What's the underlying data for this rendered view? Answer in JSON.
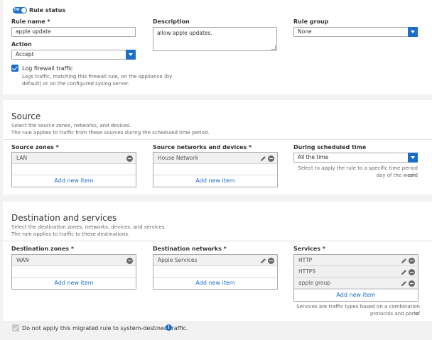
{
  "rule_status": {
    "toggle_label": "ON",
    "label": "Rule status"
  },
  "rule_name": {
    "label": "Rule name *",
    "value": "apple update"
  },
  "description": {
    "label": "Description",
    "value": "allow apple updates."
  },
  "rule_group": {
    "label": "Rule group",
    "value": "None"
  },
  "action": {
    "label": "Action",
    "value": "Accept"
  },
  "log": {
    "label": "Log firewall traffic",
    "hint_line1": "Logs traffic, matching this firewall rule, on the appliance (by",
    "hint_line2": "default) or on the configured syslog server.",
    "checked": true
  },
  "source": {
    "title": "Source",
    "desc_line1": "Select the source zones, networks, and devices.",
    "desc_line2": "The rule applies to traffic from these sources during the scheduled time period.",
    "zones": {
      "label": "Source zones *",
      "items": [
        "LAN"
      ],
      "add_label": "Add new item"
    },
    "networks": {
      "label": "Source networks and devices *",
      "items": [
        "House Network"
      ],
      "add_label": "Add new item"
    },
    "schedule": {
      "label": "During scheduled time",
      "value": "All the time",
      "hint_line1": "Select to apply the rule to a specific time period and",
      "hint_line2": "day of the week."
    }
  },
  "destination": {
    "title": "Destination and services",
    "desc_line1": "Select the destination zones, networks, devices, and services.",
    "desc_line2": "The rule applies to traffic to these destinations.",
    "zones": {
      "label": "Destination zones *",
      "items": [
        "WAN"
      ],
      "add_label": "Add new item"
    },
    "networks": {
      "label": "Destination networks *",
      "items": [
        "Apple Services"
      ],
      "add_label": "Add new item"
    },
    "services": {
      "label": "Services *",
      "items": [
        "HTTP",
        "HTTPS",
        "apple group"
      ],
      "add_label": "Add new item",
      "hint_line1": "Services are traffic types based on a combination of",
      "hint_line2": "protocols and ports."
    }
  },
  "migrated": {
    "label": "Do not apply this migrated rule to system-destined traffic.",
    "info_glyph": "i",
    "checked": true
  },
  "colors": {
    "accent": "#1a6ec8",
    "row_bg": "#f0f0f0",
    "page_bg": "#f2f2f2"
  }
}
